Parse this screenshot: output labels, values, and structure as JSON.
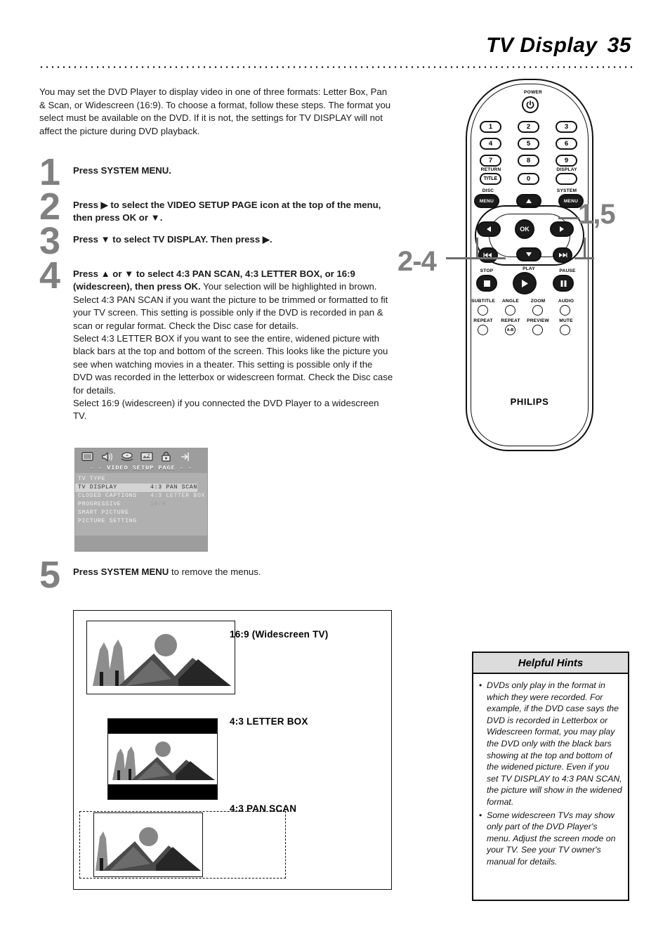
{
  "header": {
    "title": "TV Display",
    "page_number": "35"
  },
  "intro": "You may set the DVD Player to display video in one of three formats: Letter Box, Pan & Scan, or Widescreen (16:9). To choose a format, follow these steps. The format you select must be available on the DVD. If it is not, the settings for TV DISPLAY will not affect the picture during DVD playback.",
  "steps": [
    {
      "number": "1",
      "text_html": "<b>Press SYSTEM MENU.</b>"
    },
    {
      "number": "2",
      "text_html": "<b>Press ▶ to select the VIDEO SETUP PAGE icon at the top of the menu, then press OK or ▼.</b>"
    },
    {
      "number": "3",
      "text_html": "<b>Press ▼ to select TV DISPLAY.  Then press ▶.</b>"
    },
    {
      "number": "4",
      "text_html": "<b>Press ▲ or ▼ to select 4:3 PAN SCAN, 4:3 LETTER BOX, or 16:9 (widescreen), then press OK.</b> Your selection will be highlighted in brown.<br>Select 4:3 PAN SCAN if you want the picture to be trimmed or formatted to fit your TV screen. This setting is possible only if the DVD is recorded in pan &amp; scan or regular format. Check the Disc case for details.<br>Select 4:3 LETTER BOX if you want to see the entire, widened picture with black bars at the top and bottom of the screen. This looks like the picture you see when watching movies in a theater. This setting is possible only if the DVD was recorded in the letterbox or widescreen format. Check the Disc case for details.<br>Select 16:9 (widescreen) if you connected the DVD Player to a widescreen TV."
    },
    {
      "number": "5",
      "text_html": "<b>Press SYSTEM MENU</b> to remove the menus."
    }
  ],
  "osd_menu": {
    "icons": [
      "tv-screen-icon",
      "speaker-icon",
      "disc-audio-icon",
      "video-picture-icon",
      "lock-icon",
      "exit-arrow-icon"
    ],
    "page_header": "- -  VIDEO  SETUP  PAGE  - -",
    "items": [
      {
        "label": "TV TYPE",
        "selected": false
      },
      {
        "label": "TV DISPLAY",
        "selected": true
      },
      {
        "label": "CLOSED CAPTIONS",
        "selected": false
      },
      {
        "label": "PROGRESSIVE",
        "selected": false
      },
      {
        "label": "SMART PICTURE",
        "selected": false
      },
      {
        "label": "PICTURE SETTING",
        "selected": false
      }
    ],
    "options": [
      {
        "label": "4:3  PAN  SCAN",
        "selected": true
      },
      {
        "label": "4:3  LETTER  BOX",
        "selected": false
      },
      {
        "label": "16:9",
        "selected": false
      }
    ]
  },
  "remote": {
    "brand": "PHILIPS",
    "power_label": "POWER",
    "power_icon": "power-icon",
    "keys": [
      "1",
      "2",
      "3",
      "4",
      "5",
      "6",
      "7",
      "8",
      "9",
      "0"
    ],
    "return_label": "RETURN",
    "title_label": "TITLE",
    "display_label": "DISPLAY",
    "disc_label": "DISC",
    "disc_menu_label": "MENU",
    "system_label": "SYSTEM",
    "system_menu_label": "MENU",
    "ok_label": "OK",
    "stop_label": "STOP",
    "play_label": "PLAY",
    "pause_label": "PAUSE",
    "fn_row1": [
      "SUBTITLE",
      "ANGLE",
      "ZOOM",
      "AUDIO"
    ],
    "fn_row2": [
      "REPEAT",
      "REPEAT",
      "PREVIEW",
      "MUTE"
    ],
    "repeat_ab_label": "A-B",
    "callouts": {
      "left": "2-4",
      "right": "1,5"
    }
  },
  "formats": [
    {
      "label": "16:9 (Widescreen TV)",
      "mode": "widescreen"
    },
    {
      "label": "4:3 LETTER BOX",
      "mode": "letterbox"
    },
    {
      "label": "4:3 PAN SCAN",
      "mode": "panscan"
    }
  ],
  "hints": {
    "title": "Helpful Hints",
    "items": [
      "DVDs only play in the format in which they were recorded. For example, if the DVD case says the DVD is recorded in Letterbox or Widescreen format, you may play the DVD only with the black bars showing at the top and bottom of the widened picture. Even if you set  TV DISPLAY to 4:3 PAN SCAN, the picture will show in the widened format.",
      "Some widescreen TVs may show only part of the DVD Player's menu. Adjust the screen mode on your TV. See your TV owner's manual for details."
    ],
    "bullet": "•"
  },
  "colors": {
    "accent_gray": "#808080",
    "osd_bg": "#b0b0b0",
    "osd_highlight": "#d4d4d4",
    "hint_header_bg": "#dcdcdc"
  }
}
